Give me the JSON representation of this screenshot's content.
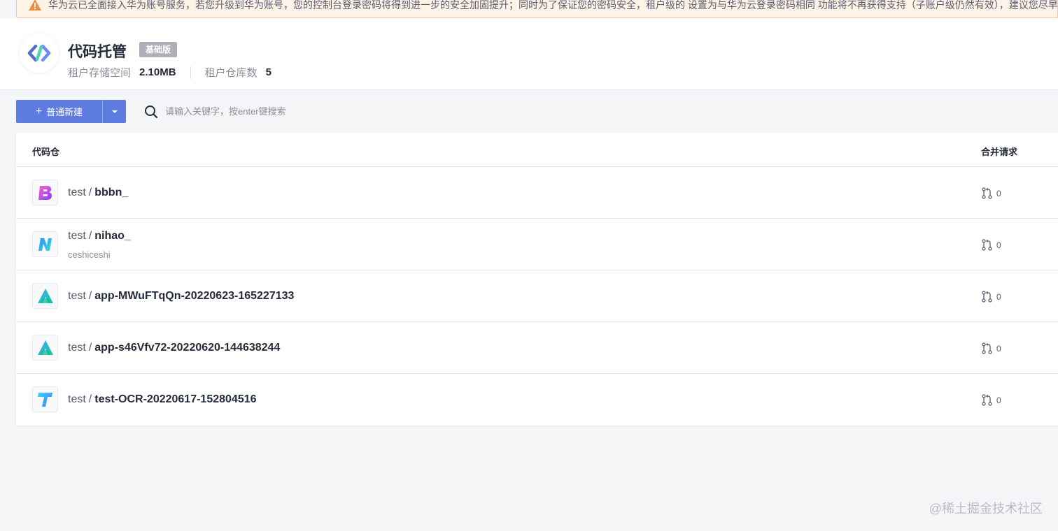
{
  "banner": {
    "text": "华为云已全面接入华为账号服务，若您升级到华为账号，您的控制台登录密码将得到进一步的安全加固提升；同时为了保证您的密码安全，租户级的 设置为与华为云登录密码相同 功能将不再获得支持（子账户级仍然有效），建议您尽早"
  },
  "header": {
    "title": "代码托管",
    "badge": "基础版",
    "storage_label": "租户存储空间",
    "storage_value": "2.10MB",
    "repo_count_label": "租户仓库数",
    "repo_count_value": "5"
  },
  "toolbar": {
    "new_label": "普通新建",
    "search_placeholder": "请输入关键字，按enter键搜索"
  },
  "table": {
    "col_repo": "代码仓",
    "col_mr": "合并请求",
    "rows": [
      {
        "owner": "test",
        "sep": "/",
        "name": "bbbn_",
        "desc": "",
        "mr": "0",
        "avatar": "letter-b-icon"
      },
      {
        "owner": "test",
        "sep": "/",
        "name": "nihao_",
        "desc": "ceshiceshi",
        "mr": "0",
        "avatar": "letter-n-icon"
      },
      {
        "owner": "test",
        "sep": "/",
        "name": "app-MWuFTqQn-20220623-165227133",
        "desc": "",
        "mr": "0",
        "avatar": "letter-a-icon"
      },
      {
        "owner": "test",
        "sep": "/",
        "name": "app-s46Vfv72-20220620-144638244",
        "desc": "",
        "mr": "0",
        "avatar": "letter-a-icon"
      },
      {
        "owner": "test",
        "sep": "/",
        "name": "test-OCR-20220617-152804516",
        "desc": "",
        "mr": "0",
        "avatar": "letter-t-icon"
      }
    ]
  },
  "watermark": "@稀土掘金技术社区",
  "colors": {
    "primary": "#5e7ce0",
    "warning_bg": "#fff3e8",
    "badge_bg": "#adb0b8"
  }
}
